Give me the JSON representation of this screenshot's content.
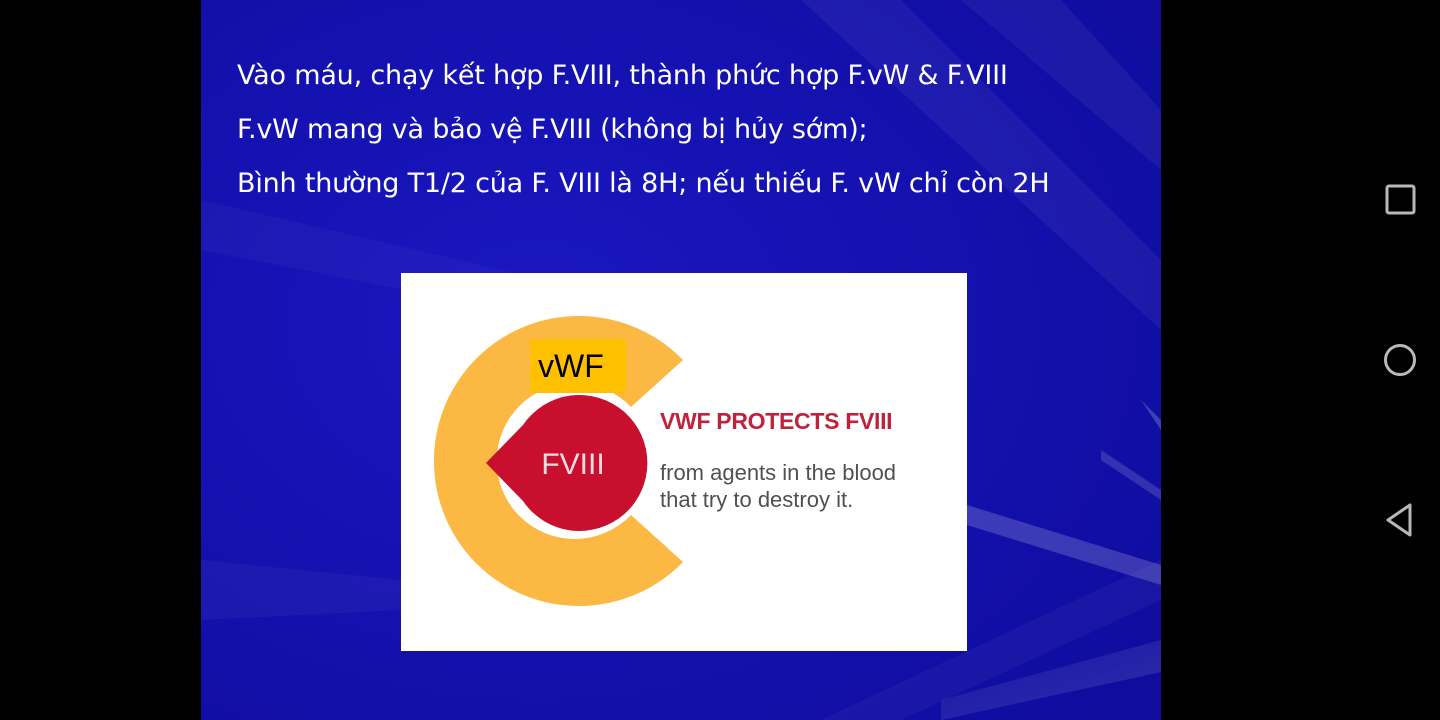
{
  "slide": {
    "lines": [
      "Vào máu, chạy kết hợp F.VIII, thành phức hợp F.vW & F.VIII",
      "F.vW mang và bảo vệ F.VIII (không bị hủy sớm);",
      "Bình thường T1/2 của F. VIII là 8H; nếu thiếu F. vW chỉ còn 2H"
    ],
    "figure": {
      "vwf_label": "vWF",
      "fviii_label": "FVIII",
      "headline": "VWF PROTECTS FVIII",
      "subtext_line1": "from agents in the blood",
      "subtext_line2": "that try to destroy it."
    }
  },
  "colors": {
    "slide_background": "#1512b4",
    "text": "#ffffff",
    "vwf_orange": "#fbb843",
    "vwf_label_box": "#ffc000",
    "fviii_red": "#c8102e",
    "headline_red": "#c0223b",
    "subtext_gray": "#505050"
  },
  "navigation": {
    "recents_icon": "square-icon",
    "home_icon": "circle-icon",
    "back_icon": "triangle-back-icon"
  }
}
